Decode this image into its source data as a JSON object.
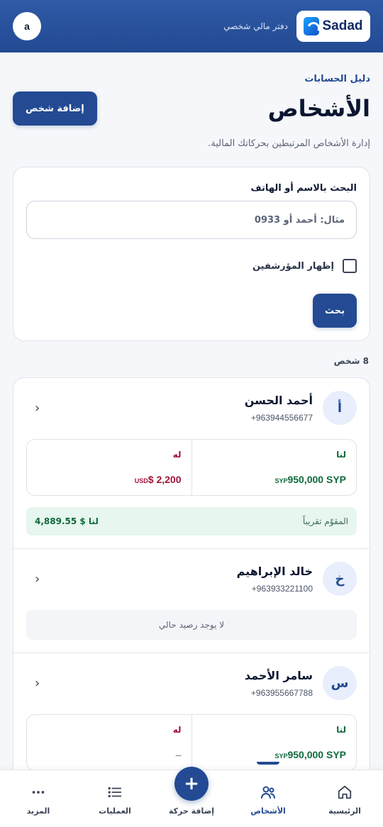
{
  "header": {
    "brand_name": "Sadad",
    "brand_subtitle": "دفتر مالي شخصي",
    "user_initial": "a"
  },
  "page": {
    "breadcrumb": "دليل الحسابات",
    "title": "الأشخاص",
    "add_button": "إضافة شخص",
    "subtitle": "إدارة الأشخاص المرتبطين بحركاتك المالية."
  },
  "search": {
    "label": "البحث بالاسم أو الهاتف",
    "placeholder": "مثال: أحمد أو 0933",
    "show_archived_label": "إظهار المؤرشفين",
    "show_archived_checked": false,
    "button": "بحث"
  },
  "results_count": "8 شخص",
  "people": [
    {
      "initial": "أ",
      "name": "أحمد الحسن",
      "phone": "+963944556677",
      "for_us_label": "لنا",
      "for_us_amount": "950,000 SYP",
      "for_us_currency": "SYP",
      "for_them_label": "له",
      "for_them_amount": "$ 2,200",
      "for_them_currency": "USD",
      "approx_label": "المقوّم تقريباً",
      "approx_value": "لنا $ 4,889.55"
    },
    {
      "initial": "خ",
      "name": "خالد الإبراهيم",
      "phone": "+963933221100",
      "no_balance": "لا يوجد رصيد حالي"
    },
    {
      "initial": "س",
      "name": "سامر الأحمد",
      "phone": "+963955667788",
      "for_us_label": "لنا",
      "for_us_amount": "950,000 SYP",
      "for_us_currency": "SYP",
      "for_them_label": "له",
      "for_them_amount": "–"
    }
  ],
  "bottom_nav": {
    "home": "الرئيسية",
    "people": "الأشخاص",
    "add_transaction": "إضافة حركة",
    "operations": "العمليات",
    "more": "المزيد"
  },
  "colors": {
    "primary": "#234a93",
    "positive": "#0f6a3c",
    "negative": "#a2133a",
    "approx_bg": "#e7f6ee"
  }
}
